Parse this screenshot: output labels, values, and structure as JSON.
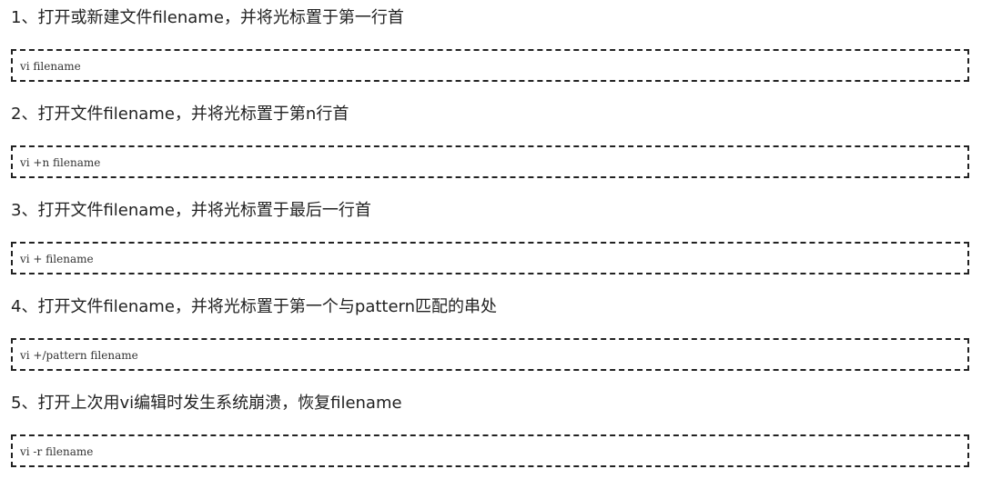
{
  "items": [
    {
      "heading": "1、打开或新建文件filename，并将光标置于第一行首",
      "command": "vi filename"
    },
    {
      "heading": "2、打开文件filename，并将光标置于第n行首",
      "command": "vi +n filename"
    },
    {
      "heading": "3、打开文件filename，并将光标置于最后一行首",
      "command": "vi + filename"
    },
    {
      "heading": "4、打开文件filename，并将光标置于第一个与pattern匹配的串处",
      "command": "vi +/pattern filename"
    },
    {
      "heading": "5、打开上次用vi编辑时发生系统崩溃，恢复filename",
      "command": "vi -r filename"
    }
  ]
}
